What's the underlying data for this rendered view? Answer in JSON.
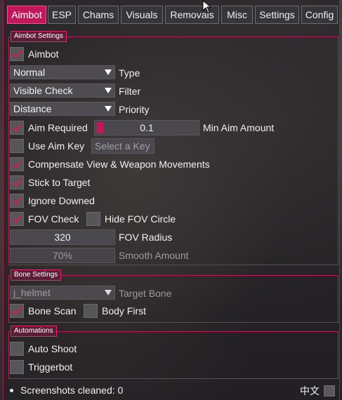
{
  "tabs": [
    "Aimbot",
    "ESP",
    "Chams",
    "Visuals",
    "Removals",
    "Misc",
    "Settings",
    "Config"
  ],
  "colors": {
    "accent": "#c2185b",
    "border": "#b31f55"
  },
  "aimbot_settings": {
    "title": "Aimbot Settings",
    "aimbot": {
      "label": "Aimbot",
      "checked": true
    },
    "type": {
      "value": "Normal",
      "label": "Type"
    },
    "filter": {
      "value": "Visible Check",
      "label": "Filter"
    },
    "priority": {
      "value": "Distance",
      "label": "Priority"
    },
    "aim_required": {
      "label": "Aim Required",
      "checked": true,
      "value": "0.1",
      "slider_label": "Min Aim Amount"
    },
    "use_aim_key": {
      "label": "Use Aim Key",
      "checked": false,
      "key": "Select a Key"
    },
    "compensate": {
      "label": "Compensate View & Weapon Movements",
      "checked": true
    },
    "stick": {
      "label": "Stick to Target",
      "checked": true
    },
    "ignore_downed": {
      "label": "Ignore Downed",
      "checked": true
    },
    "fov_check": {
      "label": "FOV Check",
      "checked": true
    },
    "hide_fov": {
      "label": "Hide FOV Circle",
      "checked": false
    },
    "fov_radius": {
      "value": "320",
      "label": "FOV Radius"
    },
    "smooth": {
      "value": "70%",
      "label": "Smooth Amount"
    }
  },
  "bone_settings": {
    "title": "Bone Settings",
    "target_bone": {
      "value": "j_helmet",
      "label": "Target Bone"
    },
    "bone_scan": {
      "label": "Bone Scan",
      "checked": true
    },
    "body_first": {
      "label": "Body First",
      "checked": false
    }
  },
  "automations": {
    "title": "Automations",
    "auto_shoot": {
      "label": "Auto Shoot",
      "checked": false
    },
    "triggerbot": {
      "label": "Triggerbot",
      "checked": false
    }
  },
  "status": {
    "text": "Screenshots cleaned: 0",
    "language": "中文"
  }
}
